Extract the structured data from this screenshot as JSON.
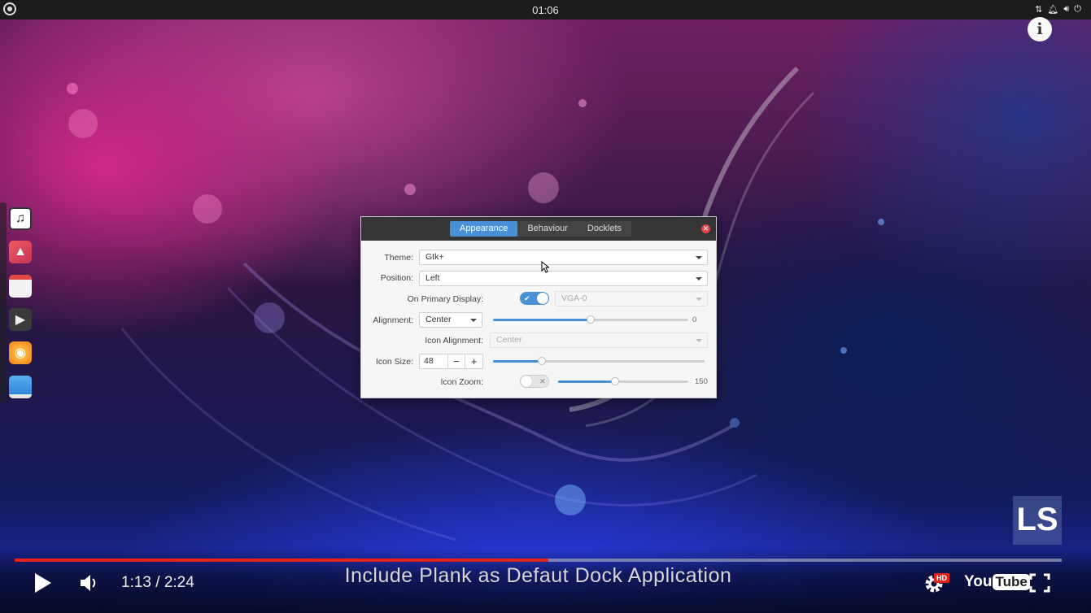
{
  "top_panel": {
    "clock": "01:06",
    "tray_icons": [
      "network-icon",
      "notification-icon",
      "volume-icon",
      "power-icon"
    ]
  },
  "info_button": "i",
  "dock": {
    "apps": [
      {
        "name": "music",
        "icon": "music-note-icon"
      },
      {
        "name": "photos",
        "icon": "image-icon"
      },
      {
        "name": "calendar",
        "icon": "calendar-icon"
      },
      {
        "name": "videos",
        "icon": "play-icon"
      },
      {
        "name": "firefox",
        "icon": "firefox-icon"
      },
      {
        "name": "files",
        "icon": "folder-window-icon"
      }
    ]
  },
  "dialog": {
    "tabs": [
      {
        "label": "Appearance",
        "active": true
      },
      {
        "label": "Behaviour",
        "active": false
      },
      {
        "label": "Docklets",
        "active": false
      }
    ],
    "theme": {
      "label": "Theme:",
      "value": "Gtk+"
    },
    "position": {
      "label": "Position:",
      "value": "Left"
    },
    "primary_display": {
      "label": "On Primary Display:",
      "enabled": true,
      "display_value": "VGA-0"
    },
    "alignment": {
      "label": "Alignment:",
      "value": "Center",
      "offset_value": "0",
      "slider_fraction": 0.5
    },
    "icon_alignment": {
      "label": "Icon Alignment:",
      "value": "Center"
    },
    "icon_size": {
      "label": "Icon Size:",
      "value": "48",
      "minus": "−",
      "plus": "+",
      "slider_fraction": 0.23
    },
    "icon_zoom": {
      "label": "Icon Zoom:",
      "enabled": false,
      "value": "150",
      "slider_fraction": 0.44
    }
  },
  "player": {
    "time": "1:13 / 2:24",
    "progress_fraction": 0.51,
    "caption": "Include Plank as Defaut Dock Application",
    "hd_badge": "HD",
    "logo_you": "You",
    "logo_tube": "Tube",
    "watermark": "LS"
  },
  "colors": {
    "accent": "#4a90d9",
    "progress": "#e62117",
    "close": "#e2444e"
  }
}
